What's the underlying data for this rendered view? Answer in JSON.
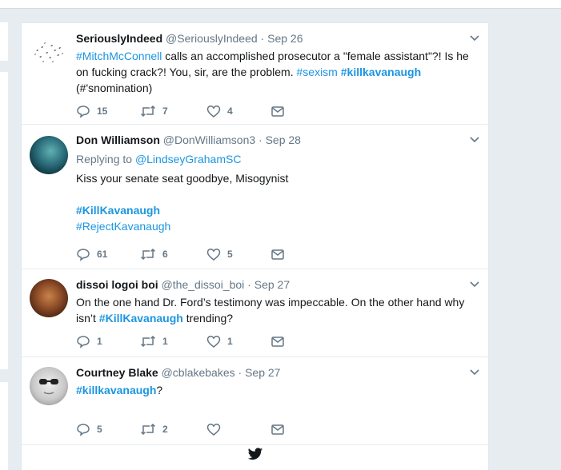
{
  "tweets": [
    {
      "name": "SeriouslyIndeed",
      "handle": "@SeriouslyIndeed",
      "date": "Sep 26",
      "reply_prefix": "",
      "reply_to": "",
      "line1": {
        "a": "#MitchMcConnell",
        "b": " calls an accomplished prosecutor a \"female assistant\"?! Is he"
      },
      "line2": {
        "a": "on fucking crack?! You, sir, are the problem. ",
        "b": "#sexism",
        "c": " ",
        "d": "#killkavanaugh"
      },
      "line3": "(#'snomination)",
      "replies": "15",
      "retweets": "7",
      "likes": "4"
    },
    {
      "name": "Don Williamson",
      "handle": "@DonWilliamson3",
      "date": "Sep 28",
      "reply_prefix": "Replying to ",
      "reply_to": "@LindseyGrahamSC",
      "line1": "Kiss your senate seat goodbye, Misogynist",
      "tag1": "#KillKavanaugh",
      "tag2": "#RejectKavanaugh",
      "replies": "61",
      "retweets": "6",
      "likes": "5"
    },
    {
      "name": "dissoi logoi boi",
      "handle": "@the_dissoi_boi",
      "date": "Sep 27",
      "line1": "On the one hand Dr. Ford’s testimony was impeccable. On the other hand why",
      "line2": {
        "a": "isn’t ",
        "b": "#KillKavanaugh",
        "c": " trending?"
      },
      "replies": "1",
      "retweets": "1",
      "likes": "1"
    },
    {
      "name": "Courtney Blake",
      "handle": "@cblakebakes",
      "date": "Sep 27",
      "line1": {
        "a": "#killkavanaugh",
        "b": "?"
      },
      "replies": "5",
      "retweets": "2",
      "likes": ""
    }
  ],
  "separator": " · ",
  "colors": {
    "accent": "#1b95e0",
    "muted": "#657786",
    "text": "#14171a",
    "background": "#e6ecf0"
  },
  "icons": [
    "reply-icon",
    "retweet-icon",
    "like-icon",
    "message-icon",
    "chevron-down-icon",
    "twitter-bird-icon"
  ]
}
